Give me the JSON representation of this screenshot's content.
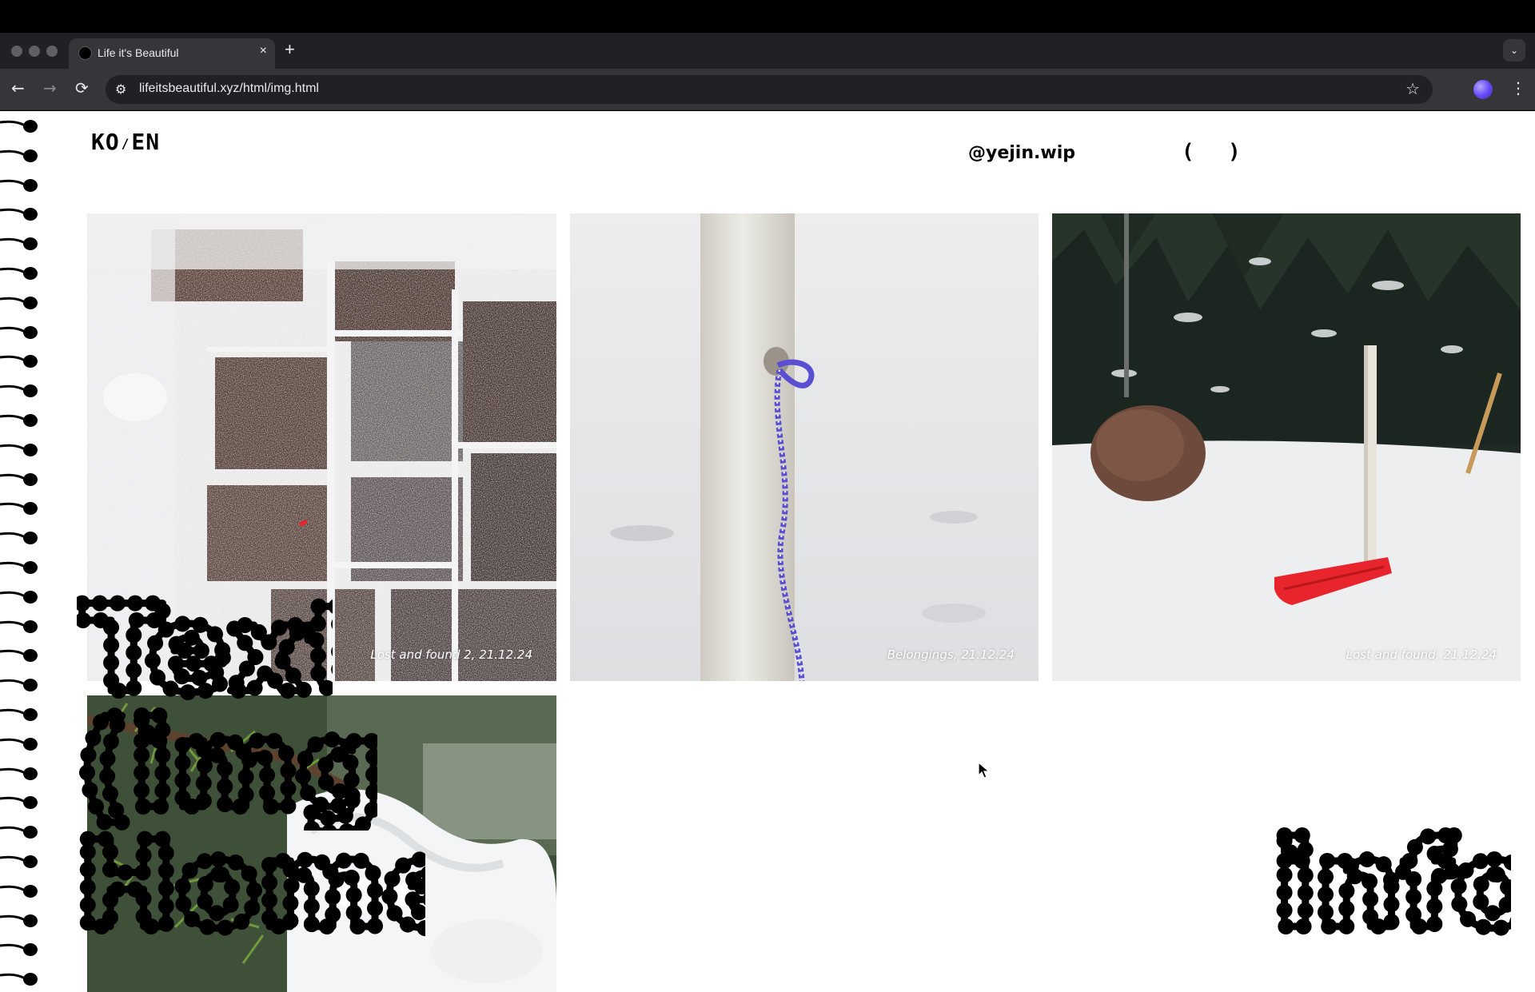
{
  "browser": {
    "tab_title": "Life it's Beautiful",
    "tab_close": "×",
    "new_tab": "+",
    "tab_menu": "⌄",
    "back": "←",
    "forward": "→",
    "reload": "⟳",
    "site_info": "⚙",
    "url": "lifeitsbeautiful.xyz/html/img.html",
    "bookmark_star": "☆",
    "more_menu": "⋮"
  },
  "header": {
    "lang_ko": "KO",
    "lang_separator": "/",
    "lang_en": "EN",
    "instagram_handle": "@yejin.wip",
    "bracket_open": "(",
    "bracket_close": ")"
  },
  "gallery": {
    "photos": [
      {
        "caption": "Lost and found 2, 21.12.24"
      },
      {
        "caption": "Belongings, 21.12.24"
      },
      {
        "caption": "Lost and found, 21.12.24"
      },
      {
        "caption": ""
      }
    ]
  },
  "nav": {
    "text": "Text",
    "img": "(img)",
    "home": "Home",
    "info": "info"
  },
  "colors": {
    "browser_dark": "#202124",
    "browser_toolbar": "#35363a",
    "page_bg": "#ffffff",
    "ink": "#000000",
    "sled_red": "#e8252c",
    "rope_blue": "#5a4fd0"
  }
}
